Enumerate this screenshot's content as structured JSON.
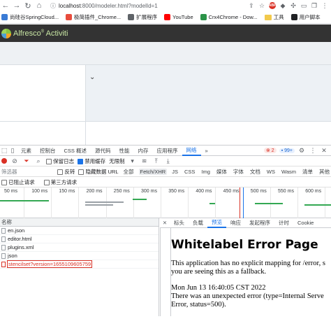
{
  "browser": {
    "url_host": "localhost",
    "url_rest": ":8000/modeler.html?modelId=1",
    "bookmarks": [
      {
        "label": "尚硅谷SpringCloud...",
        "color": "#3a7bd5"
      },
      {
        "label": "极简插件_Chrome...",
        "color": "#e84c3d"
      },
      {
        "label": "扩展程序",
        "color": "#5f6368"
      },
      {
        "label": "YouTube",
        "color": "#ff0000"
      },
      {
        "label": "Crx4Chrome - Dow...",
        "color": "#2b9348"
      },
      {
        "label": "工具",
        "color": "#f2c94c"
      },
      {
        "label": "用户脚本",
        "color": "#202124"
      }
    ],
    "abp_label": "ABP"
  },
  "app": {
    "logo_text": "Alfresco",
    "logo_product": "Activiti",
    "collapse_glyph": "⌄"
  },
  "devtools": {
    "tabs": [
      "元素",
      "控制台",
      "CSS 概述",
      "源代码",
      "性能",
      "内存",
      "应用程序",
      "网络",
      "»"
    ],
    "active_tab": "网络",
    "error_count": "2",
    "message_count": "99+",
    "toolbar": {
      "preserve_log": "保留日志",
      "disable_cache": "禁用缓存",
      "throttle": "无限制"
    },
    "filter": {
      "placeholder": "筛选器",
      "invert": "反转",
      "hide_data_urls": "隐藏数据 URL",
      "types": [
        "全部",
        "Fetch/XHR",
        "JS",
        "CSS",
        "Img",
        "媒体",
        "字体",
        "文档",
        "WS",
        "Wasm",
        "清单",
        "其他"
      ],
      "active_type": "Fetch/XHR"
    },
    "options": {
      "blocked": "已阻止请求",
      "third_party": "第三方请求"
    },
    "timeline_ticks": [
      "50 ms",
      "100 ms",
      "150 ms",
      "200 ms",
      "250 ms",
      "300 ms",
      "350 ms",
      "400 ms",
      "450 ms",
      "500 ms",
      "550 ms",
      "600 ms"
    ],
    "request_header": "名称",
    "requests": [
      {
        "name": "en.json",
        "error": false
      },
      {
        "name": "editor.html",
        "error": false
      },
      {
        "name": "plugins.xml",
        "error": false
      },
      {
        "name": "json",
        "error": false
      },
      {
        "name": "stencilset?version=1655109605759",
        "error": true
      }
    ],
    "detail_tabs": [
      "标头",
      "负载",
      "预览",
      "响应",
      "发起程序",
      "计时",
      "Cookie"
    ],
    "active_detail_tab": "预览",
    "preview": {
      "title": "Whitelabel Error Page",
      "line1": "This application has no explicit mapping for /error, s",
      "line2": "you are seeing this as a fallback.",
      "line3": "Mon Jun 13 16:40:05 CST 2022",
      "line4": "There was an unexpected error (type=Internal Serve",
      "line5": "Error, status=500)."
    }
  }
}
